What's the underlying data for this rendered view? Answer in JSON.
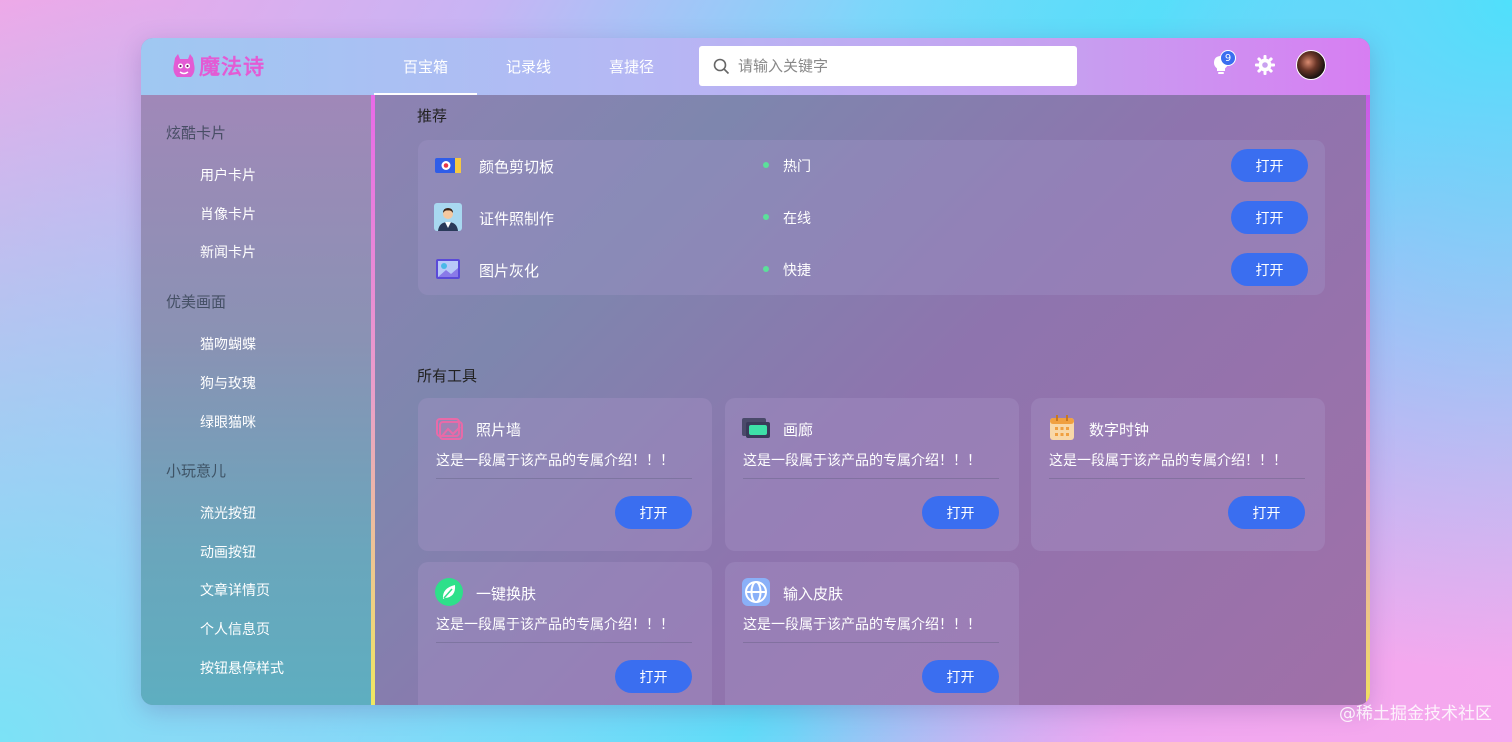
{
  "header": {
    "logo_text": "魔法诗",
    "tabs": [
      "百宝箱",
      "记录线",
      "喜捷径"
    ],
    "search_placeholder": "请输入关键字",
    "notification_count": "9"
  },
  "sidebar": {
    "groups": [
      {
        "title": "炫酷卡片",
        "items": [
          "用户卡片",
          "肖像卡片",
          "新闻卡片"
        ]
      },
      {
        "title": "优美画面",
        "items": [
          "猫吻蝴蝶",
          "狗与玫瑰",
          "绿眼猫咪"
        ]
      },
      {
        "title": "小玩意儿",
        "items": [
          "流光按钮",
          "动画按钮",
          "文章详情页",
          "个人信息页",
          "按钮悬停样式"
        ]
      }
    ]
  },
  "main": {
    "recommend_title": "推荐",
    "recommend": [
      {
        "name": "颜色剪切板",
        "tag": "热门",
        "button": "打开"
      },
      {
        "name": "证件照制作",
        "tag": "在线",
        "button": "打开"
      },
      {
        "name": "图片灰化",
        "tag": "快捷",
        "button": "打开"
      }
    ],
    "tools_title": "所有工具",
    "tools": [
      {
        "name": "照片墙",
        "desc": "这是一段属于该产品的专属介绍！！！",
        "button": "打开"
      },
      {
        "name": "画廊",
        "desc": "这是一段属于该产品的专属介绍！！！",
        "button": "打开"
      },
      {
        "name": "数字时钟",
        "desc": "这是一段属于该产品的专属介绍！！！",
        "button": "打开"
      },
      {
        "name": "一键换肤",
        "desc": "这是一段属于该产品的专属介绍！！！",
        "button": "打开"
      },
      {
        "name": "输入皮肤",
        "desc": "这是一段属于该产品的专属介绍！！！",
        "button": "打开"
      }
    ]
  },
  "watermark": "@稀土掘金技术社区",
  "colors": {
    "accent": "#3a6ef0",
    "logo": "#e35bd4",
    "online_dot": "#5be09a"
  }
}
